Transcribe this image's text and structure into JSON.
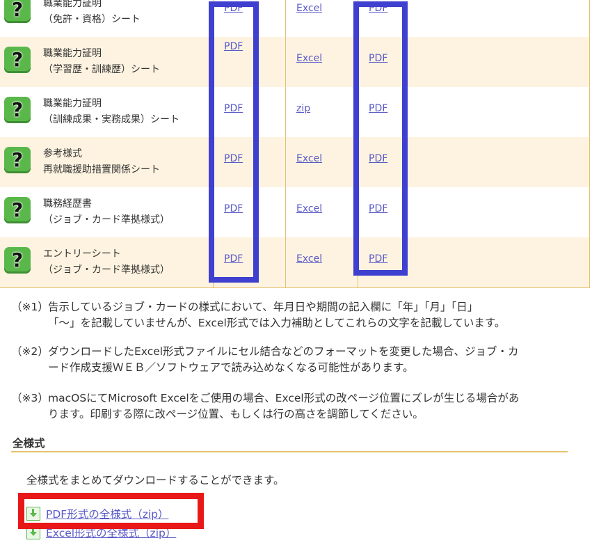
{
  "rows": [
    {
      "name1": "職業能力証明",
      "name2": "（免許・資格）シート",
      "pdf": "PDF",
      "excel": "Excel",
      "pdf2": "PDF"
    },
    {
      "name1": "職業能力証明",
      "name2": "（学習歴・訓練歴）シート",
      "pdf": "PDF",
      "excel": "Excel",
      "pdf2": "PDF"
    },
    {
      "name1": "職業能力証明",
      "name2": "（訓練成果・実務成果）シート",
      "pdf": "PDF",
      "excel": "zip",
      "pdf2": "PDF"
    },
    {
      "name1": "参考様式",
      "name2": "再就職援助措置関係シート",
      "pdf": "PDF",
      "excel": "Excel",
      "pdf2": "PDF"
    },
    {
      "name1": "職務経歴書",
      "name2": "（ジョブ・カード準拠様式）",
      "pdf": "PDF",
      "excel": "Excel",
      "pdf2": "PDF"
    },
    {
      "name1": "エントリーシート",
      "name2": "（ジョブ・カード準拠様式）",
      "pdf": "PDF",
      "excel": "Excel",
      "pdf2": "PDF"
    }
  ],
  "notes": [
    {
      "mark": "（※1）",
      "line1": "告示しているジョブ・カードの様式において、年月日や期間の記入欄に「年」「月」「日」",
      "line2": "「～」を記載していませんが、Excel形式では入力補助としてこれらの文字を記載しています。"
    },
    {
      "mark": "（※2）",
      "line1": "ダウンロードしたExcel形式ファイルにセル結合などのフォーマットを変更した場合、ジョブ・カ",
      "line2": "ード作成支援ＷＥＢ／ソフトウェアで読み込めなくなる可能性があります。"
    },
    {
      "mark": "（※3）",
      "line1": "macOSにてMicrosoft Excelをご使用の場合、Excel形式の改ページ位置にズレが生じる場合があ",
      "line2": "ります。印刷する際に改ページ位置、もしくは行の高さを調節してください。"
    }
  ],
  "section": {
    "title": "全様式",
    "description": "全様式をまとめてダウンロードすることができます。",
    "downloads": [
      {
        "label": "PDF形式の全様式（zip）"
      },
      {
        "label": "Excel形式の全様式（zip）"
      }
    ]
  },
  "colors": {
    "accent_line": "#e6c06d",
    "row_alt": "#fdf3e0",
    "link": "#5a5ac8",
    "highlight_blue": "#3f3fd0",
    "highlight_red": "#e81818",
    "icon_green": "#5ab84a"
  },
  "icons": {
    "row_icon": "question-mark-icon",
    "download_icon": "download-icon"
  }
}
